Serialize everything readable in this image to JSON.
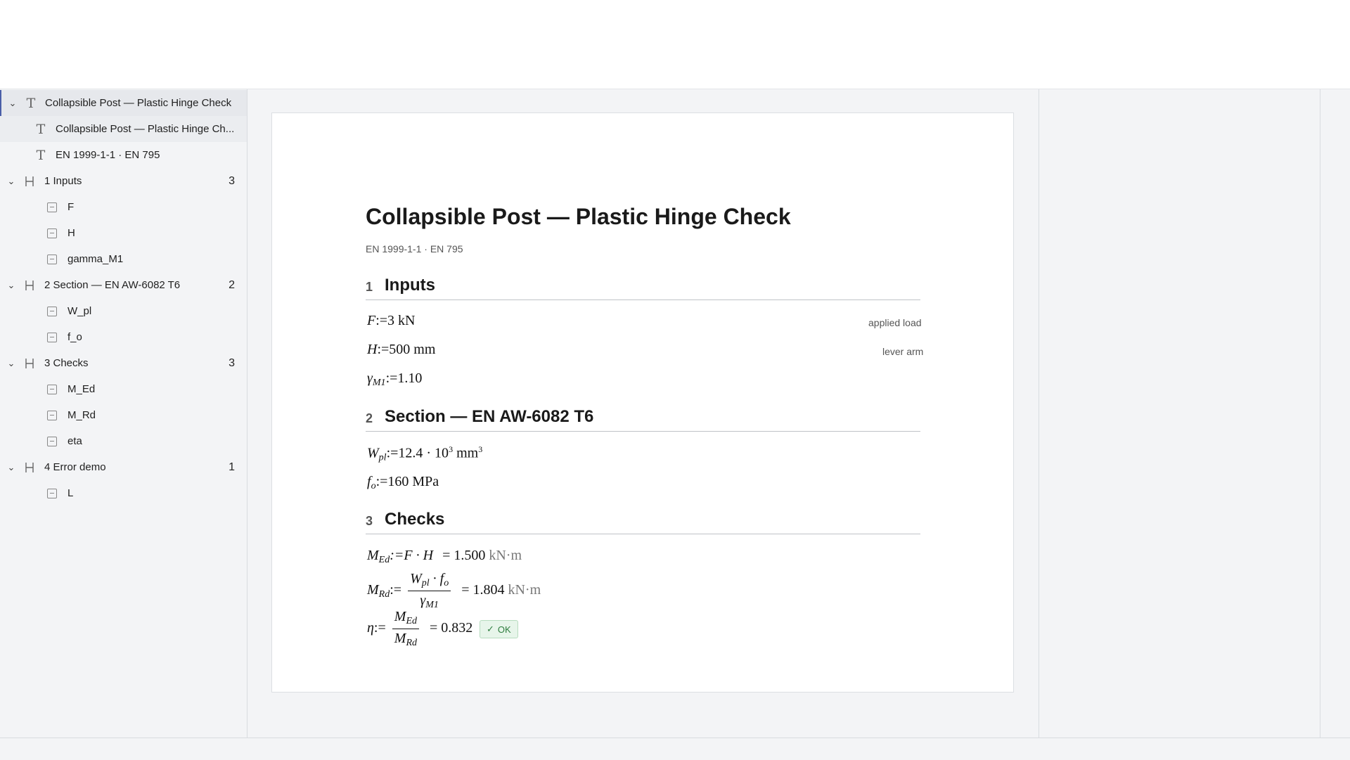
{
  "outline": {
    "rows": [
      {
        "label": "Collapsible Post — Plastic Hinge Check",
        "type": "text",
        "expanded": true
      },
      {
        "label": "Collapsible Post — Plastic Hinge Ch...",
        "type": "text"
      },
      {
        "label": "EN 1999-1-1 · EN 795",
        "type": "text"
      },
      {
        "label": "1 Inputs",
        "type": "heading",
        "count": "3"
      },
      {
        "label": "F",
        "type": "variable"
      },
      {
        "label": "H",
        "type": "variable"
      },
      {
        "label": "gamma_M1",
        "type": "variable"
      },
      {
        "label": "2 Section — EN AW-6082 T6",
        "type": "heading",
        "count": "2"
      },
      {
        "label": "W_pl",
        "type": "variable"
      },
      {
        "label": "f_o",
        "type": "variable"
      },
      {
        "label": "3 Checks",
        "type": "heading",
        "count": "3"
      },
      {
        "label": "M_Ed",
        "type": "variable"
      },
      {
        "label": "M_Rd",
        "type": "variable"
      },
      {
        "label": "eta",
        "type": "variable"
      },
      {
        "label": "4 Error demo",
        "type": "heading",
        "count": "1"
      },
      {
        "label": "L",
        "type": "variable"
      }
    ]
  },
  "document": {
    "title": "Collapsible Post — Plastic Hinge Check",
    "subtitle": "EN 1999-1-1 · EN 795",
    "sections": [
      {
        "num": "1",
        "title": "Inputs"
      },
      {
        "num": "2",
        "title": "Section — EN AW-6082 T6"
      },
      {
        "num": "3",
        "title": "Checks"
      }
    ],
    "inputs": {
      "F": {
        "sym": "F",
        "assign": ":=3 kN",
        "note": "applied load"
      },
      "H": {
        "sym": "H",
        "assign": ":=500 mm",
        "note": "lever arm"
      },
      "gamma": {
        "sym": "γ",
        "sub": "M1",
        "assign": ":=1.10"
      }
    },
    "section": {
      "Wpl": {
        "sym": "W",
        "sub": "pl",
        "assign": ":=12.4 · 10",
        "exp": "3",
        "unit": " mm",
        "unit_exp": "3"
      },
      "fo": {
        "sym": "f",
        "sub": "o",
        "assign": ":=160 MPa"
      }
    },
    "checks": {
      "MEd": {
        "sym": "M",
        "sub": "Ed",
        "expr": ":=F · H",
        "result": "= 1.500",
        "unit": "kN·m"
      },
      "MRd": {
        "sym": "M",
        "sub": "Rd",
        "assign": ":=",
        "num": "W",
        "num_sub": "pl",
        "num_mid": " · f",
        "num_sub2": "o",
        "den": "γ",
        "den_sub": "M1",
        "result": "= 1.804",
        "unit": "kN·m"
      },
      "eta": {
        "sym": "η",
        "assign": ":=",
        "num": "M",
        "num_sub": "Ed",
        "den": "M",
        "den_sub": "Rd",
        "result": "= 0.832",
        "status": "OK"
      }
    }
  },
  "colors": {
    "ok_green": "#2e7d3e",
    "selected_accent": "#4a5ea8"
  }
}
